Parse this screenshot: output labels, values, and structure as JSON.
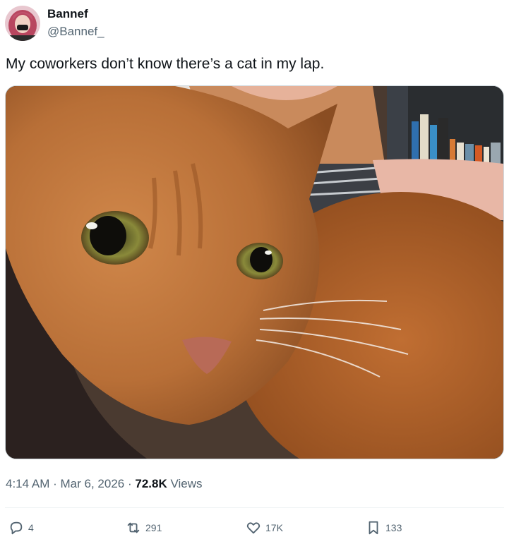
{
  "author": {
    "display_name": "Bannef",
    "handle": "@Bannef_"
  },
  "tweet": {
    "text": "My coworkers don’t know there’s a cat in my lap.",
    "media_alt": "orange-tabby-cat-photo"
  },
  "meta": {
    "time": "4:14 AM",
    "sep1": "·",
    "date": "Mar 6, 2026",
    "sep2": "·",
    "views_count": "72.8K",
    "views_label": "Views"
  },
  "actions": {
    "replies": "4",
    "reposts": "291",
    "likes": "17K",
    "bookmarks": "133"
  },
  "icons": [
    "reply-icon",
    "repost-icon",
    "like-icon",
    "bookmark-icon"
  ]
}
